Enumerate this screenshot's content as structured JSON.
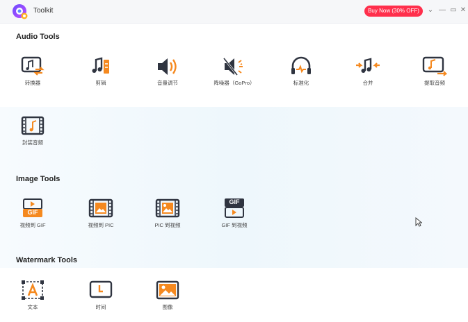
{
  "window": {
    "title": "Toolkit",
    "buy_label": "Buy Now (30% OFF)",
    "controls": {
      "menu": "⌄",
      "minimize": "—",
      "maximize": "▭",
      "close": "✕"
    }
  },
  "colors": {
    "accent_orange": "#f5891f",
    "icon_dark": "#2f3440",
    "buy_red": "#ff2f4c"
  },
  "sections": {
    "audio": {
      "title": "Audio Tools",
      "tools": [
        {
          "label": "转换器",
          "icon": "audio-converter-icon"
        },
        {
          "label": "剪辑",
          "icon": "audio-cut-icon"
        },
        {
          "label": "音量调节",
          "icon": "volume-icon"
        },
        {
          "label": "降噪器（GoPro）",
          "icon": "noise-reduction-icon"
        },
        {
          "label": "标准化",
          "icon": "normalize-icon"
        },
        {
          "label": "合并",
          "icon": "merge-icon"
        },
        {
          "label": "提取音频",
          "icon": "extract-audio-icon"
        },
        {
          "label": "封装音频",
          "icon": "package-audio-icon"
        }
      ]
    },
    "image": {
      "title": "Image Tools",
      "tools": [
        {
          "label": "视频到 GIF",
          "icon": "video-to-gif-icon"
        },
        {
          "label": "视频到 PIC",
          "icon": "video-to-pic-icon"
        },
        {
          "label": "PIC 到视频",
          "icon": "pic-to-video-icon"
        },
        {
          "label": "GIF 到视频",
          "icon": "gif-to-video-icon"
        }
      ]
    },
    "watermark": {
      "title": "Watermark Tools",
      "tools": [
        {
          "label": "文本",
          "icon": "text-watermark-icon"
        },
        {
          "label": "时间",
          "icon": "time-watermark-icon"
        },
        {
          "label": "图像",
          "icon": "image-watermark-icon"
        }
      ]
    }
  }
}
